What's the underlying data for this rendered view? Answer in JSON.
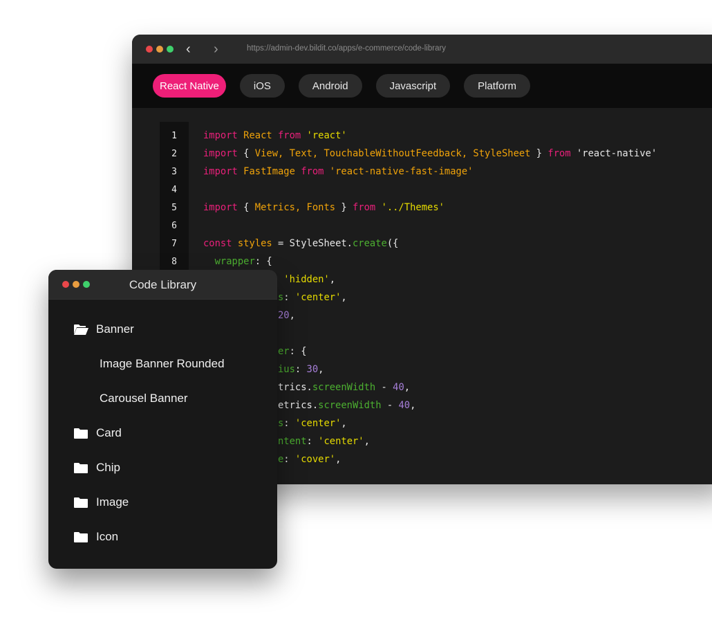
{
  "browser": {
    "url": "https://admin-dev.bildit.co/apps/e-commerce/code-library",
    "tabs": [
      {
        "label": "React Native",
        "active": true
      },
      {
        "label": "iOS"
      },
      {
        "label": "Android"
      },
      {
        "label": "Javascript"
      },
      {
        "label": "Platform"
      }
    ],
    "accent": "#ee1f78"
  },
  "code": {
    "line_numbers": [
      "1",
      "2",
      "3",
      "4",
      "5",
      "6",
      "7",
      "8"
    ],
    "colors": {
      "keyword": "#e8207a",
      "identifier": "#f0a30a",
      "string": "#e6db00",
      "property": "#4caf30",
      "number": "#a77fd9",
      "plain": "#e8e8e8"
    },
    "lines": [
      [
        [
          "import ",
          "keyword"
        ],
        [
          "React ",
          "identifier"
        ],
        [
          "from ",
          "keyword"
        ],
        [
          "'react'",
          "string"
        ]
      ],
      [
        [
          "import ",
          "keyword"
        ],
        [
          "{ ",
          "plain"
        ],
        [
          "View, Text, TouchableWithoutFeedback, StyleSheet ",
          "identifier"
        ],
        [
          "} ",
          "plain"
        ],
        [
          "from ",
          "keyword"
        ],
        [
          "'react-native'",
          "plain"
        ]
      ],
      [
        [
          "import ",
          "keyword"
        ],
        [
          "FastImage ",
          "identifier"
        ],
        [
          "from ",
          "keyword"
        ],
        [
          "'react-native-fast-image'",
          "identifier"
        ]
      ],
      [],
      [
        [
          "import ",
          "keyword"
        ],
        [
          "{ ",
          "plain"
        ],
        [
          "Metrics, Fonts ",
          "identifier"
        ],
        [
          "} ",
          "plain"
        ],
        [
          "from ",
          "keyword"
        ],
        [
          "'../Themes'",
          "string"
        ]
      ],
      [],
      [
        [
          "const ",
          "keyword"
        ],
        [
          "styles ",
          "identifier"
        ],
        [
          "= StyleSheet.",
          "plain"
        ],
        [
          "create",
          "property"
        ],
        [
          "({",
          "plain"
        ]
      ],
      [
        [
          "  wrapper",
          "property"
        ],
        [
          ": {",
          "plain"
        ]
      ],
      [
        [
          "              'hidden'",
          "string"
        ],
        [
          ",",
          "plain"
        ]
      ],
      [
        [
          "             s",
          "property"
        ],
        [
          ": ",
          "plain"
        ],
        [
          "'center'",
          "string"
        ],
        [
          ",",
          "plain"
        ]
      ],
      [
        [
          "             20",
          "number"
        ],
        [
          ",",
          "plain"
        ]
      ],
      [],
      [
        [
          "            ner",
          "property"
        ],
        [
          ": {",
          "plain"
        ]
      ],
      [
        [
          "             ius",
          "property"
        ],
        [
          ": ",
          "plain"
        ],
        [
          "30",
          "number"
        ],
        [
          ",",
          "plain"
        ]
      ],
      [
        [
          "             trics.",
          "plain"
        ],
        [
          "screenWidth ",
          "property"
        ],
        [
          "- ",
          "plain"
        ],
        [
          "40",
          "number"
        ],
        [
          ",",
          "plain"
        ]
      ],
      [
        [
          "             etrics.",
          "plain"
        ],
        [
          "screenWidth ",
          "property"
        ],
        [
          "- ",
          "plain"
        ],
        [
          "40",
          "number"
        ],
        [
          ",",
          "plain"
        ]
      ],
      [
        [
          "             s",
          "property"
        ],
        [
          ": ",
          "plain"
        ],
        [
          "'center'",
          "string"
        ],
        [
          ",",
          "plain"
        ]
      ],
      [
        [
          "             ntent",
          "property"
        ],
        [
          ": ",
          "plain"
        ],
        [
          "'center'",
          "string"
        ],
        [
          ",",
          "plain"
        ]
      ],
      [
        [
          "             e",
          "property"
        ],
        [
          ": ",
          "plain"
        ],
        [
          "'cover'",
          "string"
        ],
        [
          ",",
          "plain"
        ]
      ]
    ]
  },
  "library": {
    "title": "Code Library",
    "items": [
      {
        "label": "Banner",
        "icon": "folder-open-icon",
        "level": 0
      },
      {
        "label": "Image Banner Rounded",
        "level": 1
      },
      {
        "label": "Carousel Banner",
        "level": 1
      },
      {
        "label": "Card",
        "icon": "folder-icon",
        "level": 0
      },
      {
        "label": "Chip",
        "icon": "folder-icon",
        "level": 0
      },
      {
        "label": "Image",
        "icon": "folder-icon",
        "level": 0
      },
      {
        "label": "Icon",
        "icon": "folder-icon",
        "level": 0
      }
    ]
  }
}
